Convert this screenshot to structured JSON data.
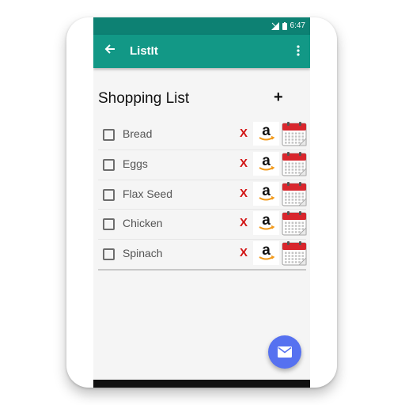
{
  "status_bar": {
    "time": "6:47",
    "icons": [
      "signal-icon",
      "battery-icon"
    ]
  },
  "app_bar": {
    "title": "ListIt",
    "back_icon": "back-arrow-icon",
    "menu_icon": "more-vert-icon"
  },
  "list": {
    "header": "Shopping List",
    "add_label": "+",
    "items": [
      {
        "label": "Bread",
        "checked": false,
        "delete_label": "X"
      },
      {
        "label": "Eggs",
        "checked": false,
        "delete_label": "X"
      },
      {
        "label": "Flax Seed",
        "checked": false,
        "delete_label": "X"
      },
      {
        "label": "Chicken",
        "checked": false,
        "delete_label": "X"
      },
      {
        "label": "Spinach",
        "checked": false,
        "delete_label": "X"
      }
    ]
  },
  "fab": {
    "icon": "email-icon",
    "color": "#5671f0"
  },
  "colors": {
    "status_bar": "#0d8173",
    "app_bar": "#129886",
    "delete": "#d21414"
  }
}
